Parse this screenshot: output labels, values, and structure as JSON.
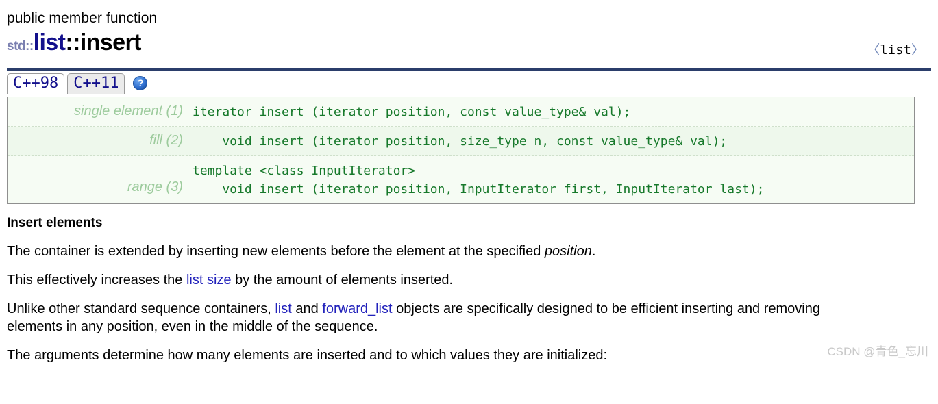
{
  "header": {
    "kind": "public member function",
    "title_std": "std::",
    "title_class": "list",
    "title_sep": "::",
    "title_function": "insert",
    "include_open": "〈",
    "include_name": "list",
    "include_close": "〉"
  },
  "tabs": [
    {
      "label": "C++98",
      "active": true
    },
    {
      "label": "C++11",
      "active": false
    }
  ],
  "help": {
    "glyph": "?"
  },
  "prototypes": [
    {
      "label": "single element (1)",
      "code": "iterator insert (iterator position, const value_type& val);",
      "shaded": false
    },
    {
      "label": "fill (2)",
      "code": "    void insert (iterator position, size_type n, const value_type& val);",
      "shaded": true
    },
    {
      "label": "range (3)",
      "code": "template <class InputIterator>\n    void insert (iterator position, InputIterator first, InputIterator last);",
      "shaded": false
    }
  ],
  "content": {
    "section_title": "Insert elements",
    "p1_a": "The container is extended by inserting new elements before the element at the specified ",
    "p1_em": "position",
    "p1_b": ".",
    "p2_a": "This effectively increases the ",
    "p2_link": "list size",
    "p2_b": " by the amount of elements inserted.",
    "p3_a": "Unlike other standard sequence containers, ",
    "p3_link1": "list",
    "p3_b": " and ",
    "p3_link2": "forward_list",
    "p3_c": " objects are specifically designed to be efficient inserting and removing elements in any position, even in the middle of the sequence.",
    "p4": "The arguments determine how many elements are inserted and to which values they are initialized:"
  },
  "watermark": {
    "text": "CSDN @青色_忘川"
  },
  "colors": {
    "rule": "#2b3e6b",
    "link": "#2222bb",
    "class_name": "#13108c",
    "std_prefix": "#7a7fb0",
    "code_text": "#17792b",
    "proto_label": "#9dcb9d",
    "proto_bg": "#f6fcf4",
    "proto_bg_shaded": "#eef8ec",
    "watermark": "#c9c9c9"
  }
}
